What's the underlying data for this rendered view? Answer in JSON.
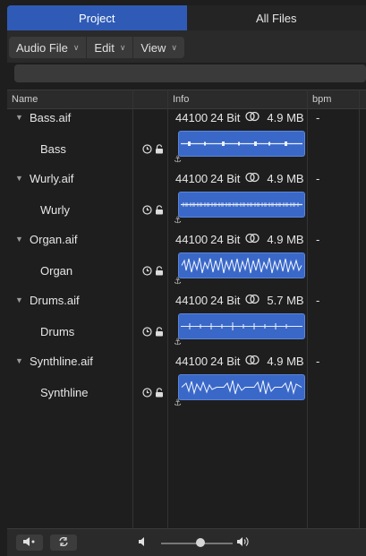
{
  "tabs": {
    "project": "Project",
    "all_files": "All Files"
  },
  "menus": {
    "audio_file": "Audio File",
    "edit": "Edit",
    "view": "View"
  },
  "columns": {
    "name": "Name",
    "info": "Info",
    "bpm": "bpm"
  },
  "files": [
    {
      "file": "Bass.aif",
      "rate": "44100",
      "bits": "24 Bit",
      "size": "4.9 MB",
      "bpm": "-",
      "region": "Bass"
    },
    {
      "file": "Wurly.aif",
      "rate": "44100",
      "bits": "24 Bit",
      "size": "4.9 MB",
      "bpm": "-",
      "region": "Wurly"
    },
    {
      "file": "Organ.aif",
      "rate": "44100",
      "bits": "24 Bit",
      "size": "4.9 MB",
      "bpm": "-",
      "region": "Organ"
    },
    {
      "file": "Drums.aif",
      "rate": "44100",
      "bits": "24 Bit",
      "size": "5.7 MB",
      "bpm": "-",
      "region": "Drums"
    },
    {
      "file": "Synthline.aif",
      "rate": "44100",
      "bits": "24 Bit",
      "size": "4.9 MB",
      "bpm": "-",
      "region": "Synthline"
    }
  ],
  "colors": {
    "accent": "#2f5bb7",
    "waveform": "#3a68c8",
    "background": "#1e1e1e"
  },
  "volume_level": 0.55
}
